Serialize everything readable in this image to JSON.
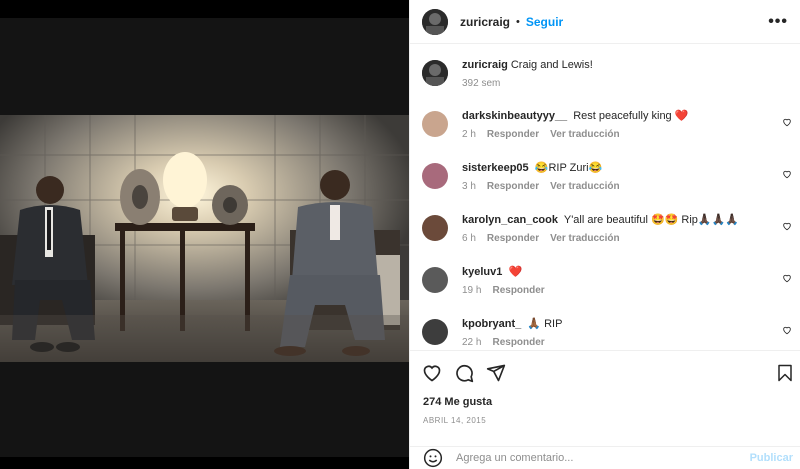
{
  "post": {
    "username": "zuricraig",
    "follow_label": "Seguir",
    "caption": "Craig and Lewis!",
    "caption_age": "392 sem"
  },
  "comments": [
    {
      "username": "darkskinbeautyyy__",
      "text": "Rest peacefully king",
      "suffix": "❤️",
      "time": "2 h",
      "reply": "Responder",
      "translate": "Ver traducción",
      "avatar_color": "#c9a58e"
    },
    {
      "username": "sisterkeep05",
      "prefix": "😂",
      "text": "RIP Zuri",
      "suffix": "😂",
      "time": "3 h",
      "reply": "Responder",
      "translate": "Ver traducción",
      "avatar_color": "#a86a7c"
    },
    {
      "username": "karolyn_can_cook",
      "text": "Y'all are beautiful 🤩🤩 Rip🙏🏿🙏🏿🙏🏿",
      "time": "6 h",
      "reply": "Responder",
      "translate": "Ver traducción",
      "avatar_color": "#6b4a3a"
    },
    {
      "username": "kyeluv1",
      "text": "",
      "suffix": "❤️",
      "time": "19 h",
      "reply": "Responder",
      "translate": "",
      "avatar_color": "#5a5a5a"
    },
    {
      "username": "kpobryant_",
      "text": "🙏🏾 RIP",
      "time": "22 h",
      "reply": "Responder",
      "translate": "",
      "avatar_color": "#3d3d3d"
    }
  ],
  "footer": {
    "likes": "274 Me gusta",
    "date": "ABRIL 14, 2015",
    "comment_placeholder": "Agrega un comentario...",
    "post_label": "Publicar"
  },
  "icons": {
    "like": "heart-icon",
    "comment": "comment-icon",
    "share": "send-icon",
    "save": "bookmark-icon",
    "emoji": "emoji-icon",
    "more": "more-options-icon"
  },
  "colors": {
    "accent": "#0095f6",
    "like_red": "#ed4956",
    "muted": "#8e8e8e"
  }
}
